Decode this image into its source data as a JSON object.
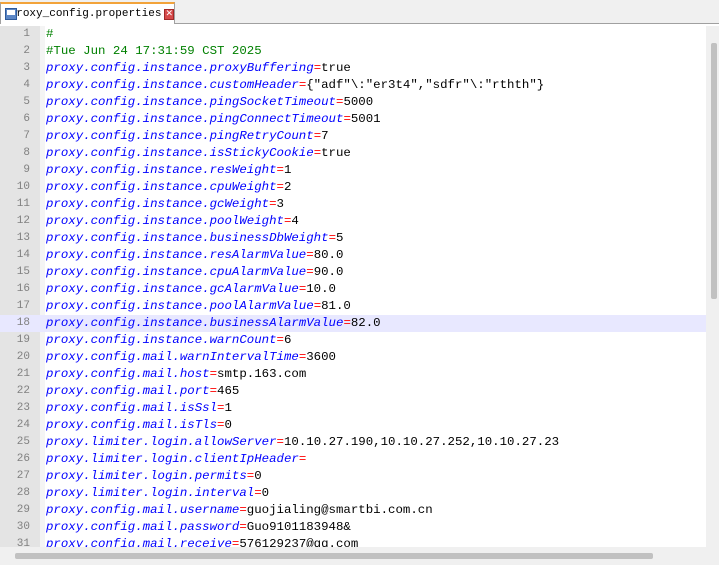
{
  "tab": {
    "title": "proxy_config.properties",
    "file_icon": "file-save-icon",
    "close_icon": "close-icon",
    "close_glyph": "✕",
    "accent": "#f2a33a"
  },
  "colors": {
    "key": "#0000ff",
    "operator": "#ff0000",
    "value": "#000000",
    "comment": "#008000",
    "current_line": "#e8e8ff",
    "gutter": "#e4e4e4"
  },
  "current_line": 18,
  "lines": [
    {
      "n": "1",
      "comment": "#"
    },
    {
      "n": "2",
      "comment": "#Tue Jun 24 17:31:59 CST 2025"
    },
    {
      "n": "3",
      "key": "proxy.config.instance.proxyBuffering",
      "op": "=",
      "value": "true"
    },
    {
      "n": "4",
      "key": "proxy.config.instance.customHeader",
      "op": "=",
      "value": "{\"adf\"\\:\"er3t4\",\"sdfr\"\\:\"rthth\"}"
    },
    {
      "n": "5",
      "key": "proxy.config.instance.pingSocketTimeout",
      "op": "=",
      "value": "5000"
    },
    {
      "n": "6",
      "key": "proxy.config.instance.pingConnectTimeout",
      "op": "=",
      "value": "5001"
    },
    {
      "n": "7",
      "key": "proxy.config.instance.pingRetryCount",
      "op": "=",
      "value": "7"
    },
    {
      "n": "8",
      "key": "proxy.config.instance.isStickyCookie",
      "op": "=",
      "value": "true"
    },
    {
      "n": "9",
      "key": "proxy.config.instance.resWeight",
      "op": "=",
      "value": "1"
    },
    {
      "n": "10",
      "key": "proxy.config.instance.cpuWeight",
      "op": "=",
      "value": "2"
    },
    {
      "n": "11",
      "key": "proxy.config.instance.gcWeight",
      "op": "=",
      "value": "3"
    },
    {
      "n": "12",
      "key": "proxy.config.instance.poolWeight",
      "op": "=",
      "value": "4"
    },
    {
      "n": "13",
      "key": "proxy.config.instance.businessDbWeight",
      "op": "=",
      "value": "5"
    },
    {
      "n": "14",
      "key": "proxy.config.instance.resAlarmValue",
      "op": "=",
      "value": "80.0"
    },
    {
      "n": "15",
      "key": "proxy.config.instance.cpuAlarmValue",
      "op": "=",
      "value": "90.0"
    },
    {
      "n": "16",
      "key": "proxy.config.instance.gcAlarmValue",
      "op": "=",
      "value": "10.0"
    },
    {
      "n": "17",
      "key": "proxy.config.instance.poolAlarmValue",
      "op": "=",
      "value": "81.0"
    },
    {
      "n": "18",
      "key": "proxy.config.instance.businessAlarmValue",
      "op": "=",
      "value": "82.0"
    },
    {
      "n": "19",
      "key": "proxy.config.instance.warnCount",
      "op": "=",
      "value": "6"
    },
    {
      "n": "20",
      "key": "proxy.config.mail.warnIntervalTime",
      "op": "=",
      "value": "3600"
    },
    {
      "n": "21",
      "key": "proxy.config.mail.host",
      "op": "=",
      "value": "smtp.163.com"
    },
    {
      "n": "22",
      "key": "proxy.config.mail.port",
      "op": "=",
      "value": "465"
    },
    {
      "n": "23",
      "key": "proxy.config.mail.isSsl",
      "op": "=",
      "value": "1"
    },
    {
      "n": "24",
      "key": "proxy.config.mail.isTls",
      "op": "=",
      "value": "0"
    },
    {
      "n": "25",
      "key": "proxy.limiter.login.allowServer",
      "op": "=",
      "value": "10.10.27.190,10.10.27.252,10.10.27.23"
    },
    {
      "n": "26",
      "key": "proxy.limiter.login.clientIpHeader",
      "op": "=",
      "value": ""
    },
    {
      "n": "27",
      "key": "proxy.limiter.login.permits",
      "op": "=",
      "value": "0"
    },
    {
      "n": "28",
      "key": "proxy.limiter.login.interval",
      "op": "=",
      "value": "0"
    },
    {
      "n": "29",
      "key": "proxy.config.mail.username",
      "op": "=",
      "value": "guojialing@smartbi.com.cn"
    },
    {
      "n": "30",
      "key": "proxy.config.mail.password",
      "op": "=",
      "value": "Guo9101183948&"
    },
    {
      "n": "31",
      "key": "proxy.config.mail.receive",
      "op": "=",
      "value": "576129237@qq.com"
    }
  ]
}
